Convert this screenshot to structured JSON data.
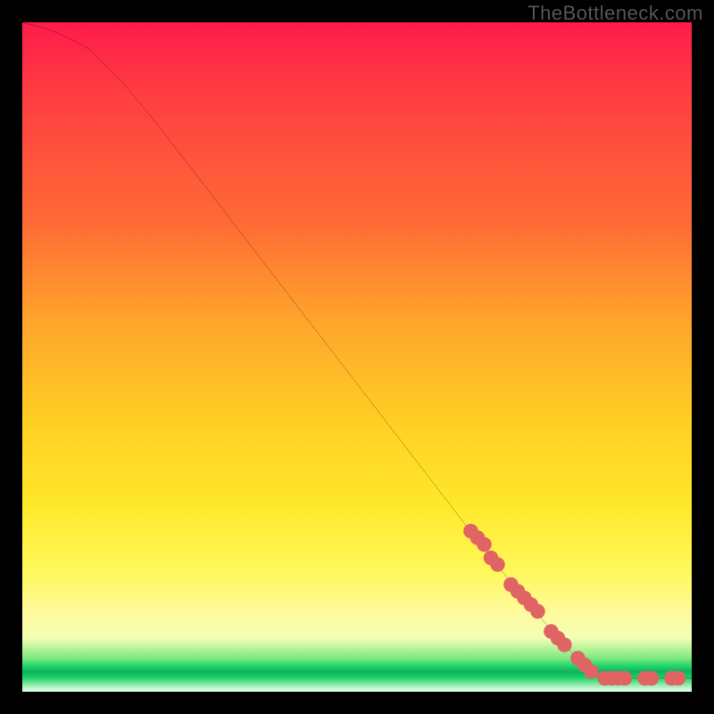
{
  "watermark": "TheBottleneck.com",
  "chart_data": {
    "type": "line",
    "title": "",
    "xlabel": "",
    "ylabel": "",
    "xlim": [
      0,
      100
    ],
    "ylim": [
      0,
      100
    ],
    "curve": {
      "name": "bottleneck-curve",
      "points": [
        {
          "x": 0,
          "y": 100
        },
        {
          "x": 5,
          "y": 99
        },
        {
          "x": 10,
          "y": 96
        },
        {
          "x": 15,
          "y": 91
        },
        {
          "x": 20,
          "y": 85
        },
        {
          "x": 30,
          "y": 72
        },
        {
          "x": 40,
          "y": 59
        },
        {
          "x": 50,
          "y": 46
        },
        {
          "x": 60,
          "y": 33
        },
        {
          "x": 70,
          "y": 20
        },
        {
          "x": 80,
          "y": 8
        },
        {
          "x": 85,
          "y": 3
        },
        {
          "x": 87,
          "y": 2
        },
        {
          "x": 100,
          "y": 2
        }
      ]
    },
    "markers": {
      "name": "highlighted-range",
      "color": "#e06464",
      "points": [
        {
          "x": 67,
          "y": 24
        },
        {
          "x": 68,
          "y": 23
        },
        {
          "x": 69,
          "y": 22
        },
        {
          "x": 70,
          "y": 20
        },
        {
          "x": 71,
          "y": 19
        },
        {
          "x": 73,
          "y": 16
        },
        {
          "x": 74,
          "y": 15
        },
        {
          "x": 75,
          "y": 14
        },
        {
          "x": 76,
          "y": 13
        },
        {
          "x": 77,
          "y": 12
        },
        {
          "x": 79,
          "y": 9
        },
        {
          "x": 80,
          "y": 8
        },
        {
          "x": 81,
          "y": 7
        },
        {
          "x": 83,
          "y": 5
        },
        {
          "x": 84,
          "y": 4
        },
        {
          "x": 85,
          "y": 3
        },
        {
          "x": 87,
          "y": 2
        },
        {
          "x": 88,
          "y": 2
        },
        {
          "x": 89,
          "y": 2
        },
        {
          "x": 90,
          "y": 2
        },
        {
          "x": 93,
          "y": 2
        },
        {
          "x": 94,
          "y": 2
        },
        {
          "x": 97,
          "y": 2
        },
        {
          "x": 98,
          "y": 2
        }
      ]
    },
    "gradient_stops": [
      {
        "pos": 0,
        "color": "#ff1b4a"
      },
      {
        "pos": 30,
        "color": "#ff6b35"
      },
      {
        "pos": 60,
        "color": "#ffd024"
      },
      {
        "pos": 88,
        "color": "#fffa9c"
      },
      {
        "pos": 96,
        "color": "#20d46a"
      },
      {
        "pos": 100,
        "color": "#e8fff0"
      }
    ]
  }
}
